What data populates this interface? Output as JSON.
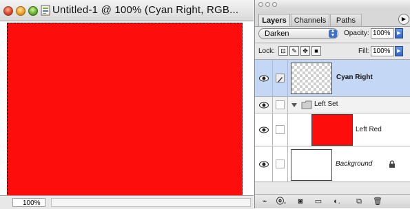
{
  "document": {
    "title": "Untitled-1 @ 100% (Cyan Right, RGB...",
    "zoom": "100%",
    "canvas_color": "#fe0d0d"
  },
  "layers_panel": {
    "tabs": [
      {
        "label": "Layers",
        "active": true
      },
      {
        "label": "Channels",
        "active": false
      },
      {
        "label": "Paths",
        "active": false
      }
    ],
    "blend_mode": "Darken",
    "opacity_label": "Opacity:",
    "opacity_value": "100%",
    "fill_label": "Fill:",
    "fill_value": "100%",
    "lock_label": "Lock:",
    "layers": [
      {
        "name": "Cyan Right",
        "selected": true,
        "thumbnail": "transparent"
      },
      {
        "name": "Left Set",
        "type": "group",
        "expanded": true
      },
      {
        "name": "Left Red",
        "thumbnail": "#fe0d0d"
      },
      {
        "name": "Background",
        "italic": true,
        "locked": true,
        "thumbnail": "#ffffff"
      }
    ],
    "bottom_icons": [
      "link-layers-icon",
      "layer-style-icon",
      "layer-mask-icon",
      "new-set-icon",
      "adjustment-layer-icon",
      "new-layer-icon",
      "trash-icon"
    ]
  }
}
